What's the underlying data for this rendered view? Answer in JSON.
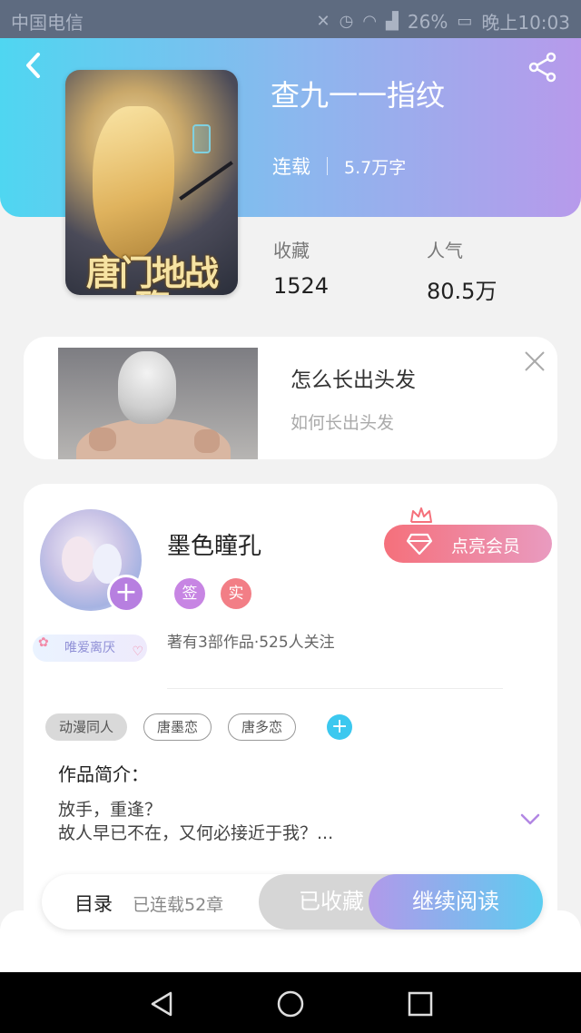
{
  "status_bar": {
    "carrier": "中国电信",
    "battery": "26%",
    "time": "晚上10:03",
    "icons": [
      "mute-icon",
      "alarm-icon",
      "wifi-icon",
      "signal-icon",
      "battery-icon"
    ]
  },
  "book": {
    "title": "查九一一指纹",
    "cover_text": "唐门地战殇",
    "status": "连载",
    "word_count": "5.7万字",
    "favorites_label": "收藏",
    "favorites_value": "1524",
    "popularity_label": "人气",
    "popularity_value": "80.5万"
  },
  "ad": {
    "title": "怎么长出头发",
    "subtitle": "如何长出头发"
  },
  "author": {
    "name": "墨色瞳孔",
    "badge_sign": "签",
    "badge_real": "实",
    "meta": "著有3部作品·525人关注",
    "fan_badge": "唯爱离厌",
    "vip_button": "点亮会员"
  },
  "tags": [
    "动漫同人",
    "唐墨恋",
    "唐多恋"
  ],
  "intro": {
    "title": "作品简介：",
    "line1": "放手，重逢？",
    "line2": "故人早已不在，又何必接近于我？..."
  },
  "action_bar": {
    "toc_label": "目录",
    "chapters": "已连载52章",
    "favorite_button": "已收藏",
    "read_button": "继续阅读"
  },
  "colors": {
    "header_gradient_start": "#4fd6f1",
    "header_gradient_end": "#b79aeb",
    "vip_gradient_start": "#f5707b",
    "read_gradient_start": "#b199ea",
    "read_gradient_end": "#5ccdf0"
  }
}
